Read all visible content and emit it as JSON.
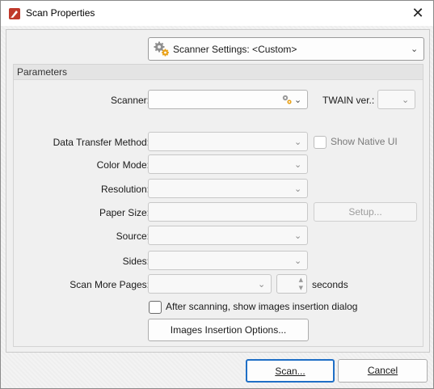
{
  "window": {
    "title": "Scan Properties",
    "close_glyph": "✕"
  },
  "scanner_settings": {
    "label": "Scanner Settings:  <Custom>"
  },
  "group": {
    "title": "Parameters"
  },
  "fields": {
    "scanner_label": "Scanner:",
    "twain_label": "TWAIN ver.:",
    "data_transfer_label": "Data Transfer Method:",
    "show_native_ui_label": "Show Native UI",
    "color_mode_label": "Color Mode:",
    "resolution_label": "Resolution:",
    "paper_size_label": "Paper Size:",
    "setup_button": "Setup...",
    "source_label": "Source:",
    "sides_label": "Sides:",
    "scan_more_pages_label": "Scan More Pages:",
    "seconds_label": "seconds",
    "after_scan_label": "After scanning, show images insertion dialog",
    "images_insertion_button": "Images Insertion Options..."
  },
  "footer": {
    "scan_button": "Scan...",
    "cancel_button": "Cancel"
  },
  "icons": {
    "app": "pdf-app-icon",
    "gear": "gears-icon",
    "close": "close-icon",
    "chevron": "chevron-down-icon"
  }
}
